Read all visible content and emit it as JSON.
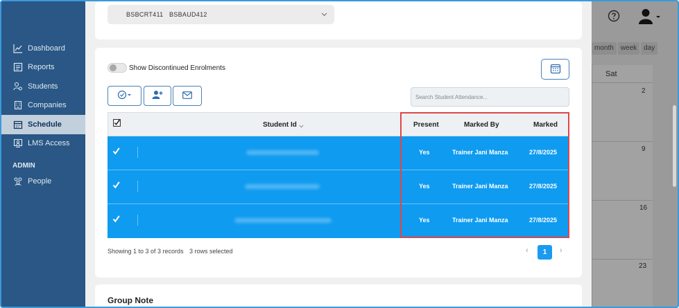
{
  "sidebar": {
    "items": [
      {
        "label": "Dashboard",
        "icon": "chart-line-icon"
      },
      {
        "label": "Reports",
        "icon": "report-icon"
      },
      {
        "label": "Students",
        "icon": "students-icon"
      },
      {
        "label": "Companies",
        "icon": "building-icon"
      },
      {
        "label": "Schedule",
        "icon": "calendar-icon",
        "active": true
      },
      {
        "label": "LMS Access",
        "icon": "monitor-user-icon"
      }
    ],
    "admin_heading": "ADMIN",
    "admin_items": [
      {
        "label": "People",
        "icon": "people-icon"
      }
    ]
  },
  "unit_select": {
    "tags": [
      "BSBCRT411",
      "BSBAUD412"
    ]
  },
  "toggle": {
    "label": "Show Discontinued Enrolments",
    "on": false
  },
  "search": {
    "placeholder": "Search Student Attendance..."
  },
  "table": {
    "columns": {
      "student_id": "Student Id",
      "present": "Present",
      "marked_by": "Marked By",
      "marked": "Marked"
    },
    "rows": [
      {
        "present": "Yes",
        "marked_by": "Trainer Jani Manza",
        "marked": "27/8/2025"
      },
      {
        "present": "Yes",
        "marked_by": "Trainer Jani Manza",
        "marked": "27/8/2025"
      },
      {
        "present": "Yes",
        "marked_by": "Trainer Jani Manza",
        "marked": "27/8/2025"
      }
    ]
  },
  "footer": {
    "records": "Showing 1 to 3 of 3 records",
    "selected": "3 rows selected",
    "page": "1",
    "prev": "‹",
    "next": "›"
  },
  "group_note": {
    "title": "Group Note"
  },
  "calendar": {
    "views": [
      "month",
      "week",
      "day"
    ],
    "day_header": "Sat",
    "days": [
      "2",
      "9",
      "16",
      "23"
    ]
  },
  "colors": {
    "sidebar": "#2a5785",
    "selected_row": "#0f9bf0",
    "highlight_border": "#e04646",
    "accent": "#4a7fb5"
  }
}
